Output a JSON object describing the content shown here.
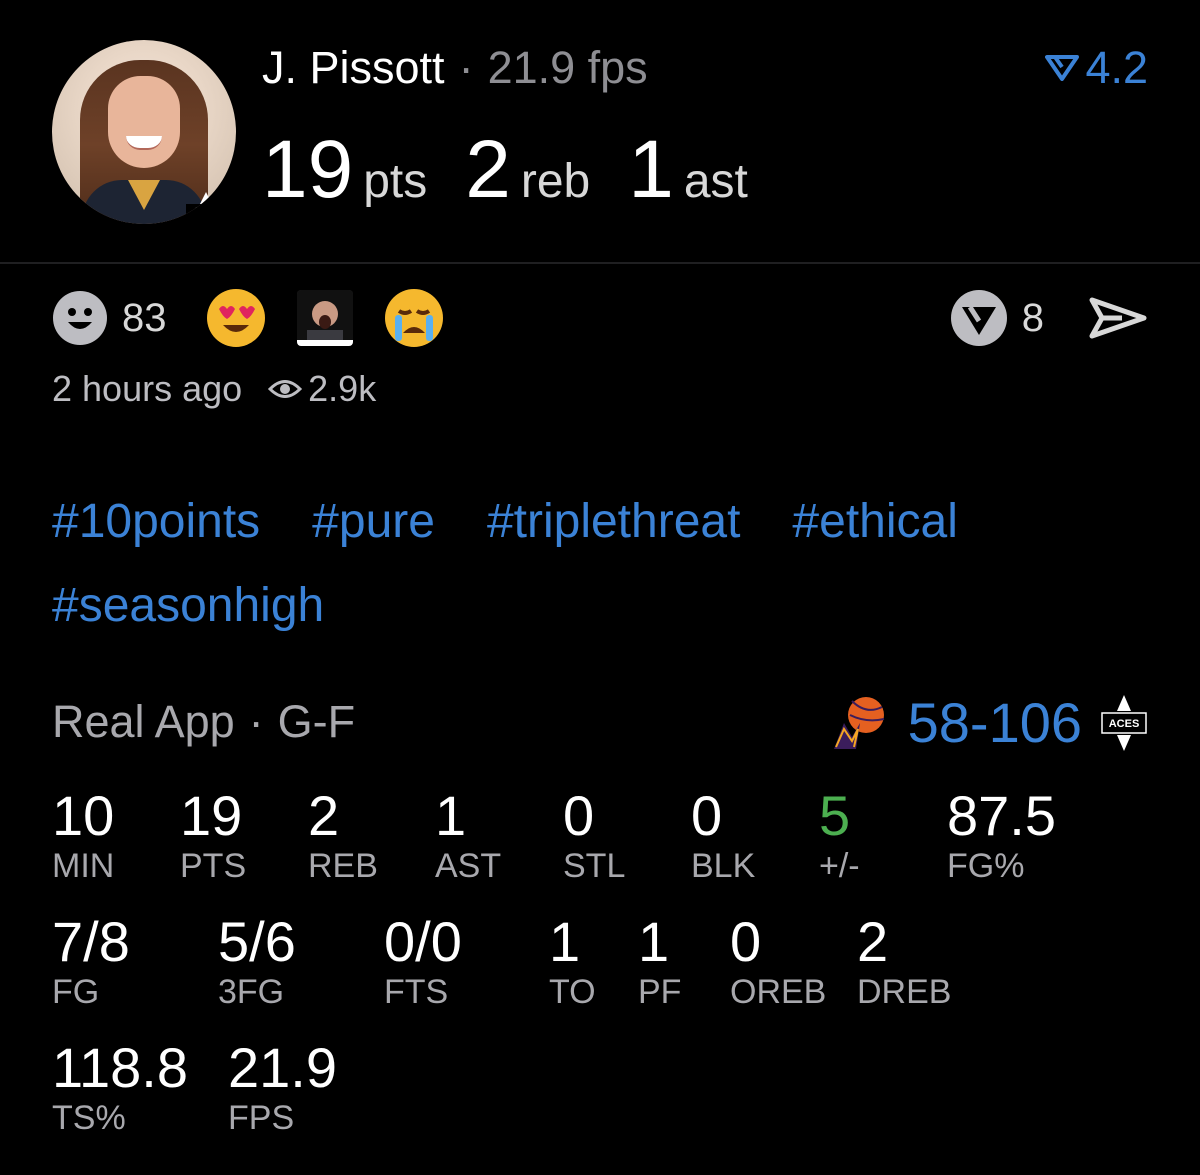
{
  "header": {
    "player_name": "J. Pissott",
    "fps_text": "21.9 fps",
    "rating": "4.2",
    "points": "19",
    "points_unit": "pts",
    "rebounds": "2",
    "rebounds_unit": "reb",
    "assists": "1",
    "assists_unit": "ast",
    "team_badge": "ACES"
  },
  "reactions": {
    "smiley_count": "83",
    "reply_count": "8"
  },
  "meta": {
    "time_ago": "2 hours ago",
    "views": "2.9k"
  },
  "hashtags": [
    "#10points",
    "#pure",
    "#triplethreat",
    "#ethical",
    "#seasonhigh"
  ],
  "game": {
    "source": "Real App",
    "position": "G-F",
    "score": "58-106",
    "home_badge": "ACES"
  },
  "stats_row1": [
    {
      "value": "10",
      "label": "MIN"
    },
    {
      "value": "19",
      "label": "PTS"
    },
    {
      "value": "2",
      "label": "REB"
    },
    {
      "value": "1",
      "label": "AST"
    },
    {
      "value": "0",
      "label": "STL"
    },
    {
      "value": "0",
      "label": "BLK"
    },
    {
      "value": "5",
      "label": "+/-"
    },
    {
      "value": "87.5",
      "label": "FG%"
    }
  ],
  "stats_row2": [
    {
      "value": "7/8",
      "label": "FG"
    },
    {
      "value": "5/6",
      "label": "3FG"
    },
    {
      "value": "0/0",
      "label": "FTS"
    },
    {
      "value": "1",
      "label": "TO"
    },
    {
      "value": "1",
      "label": "PF"
    },
    {
      "value": "0",
      "label": "OREB"
    },
    {
      "value": "2",
      "label": "DREB"
    }
  ],
  "stats_row3": [
    {
      "value": "118.8",
      "label": "TS%"
    },
    {
      "value": "21.9",
      "label": "FPS"
    }
  ],
  "colors": {
    "accent": "#3b82d6",
    "positive": "#4caf50",
    "muted": "#a8a8ad"
  }
}
